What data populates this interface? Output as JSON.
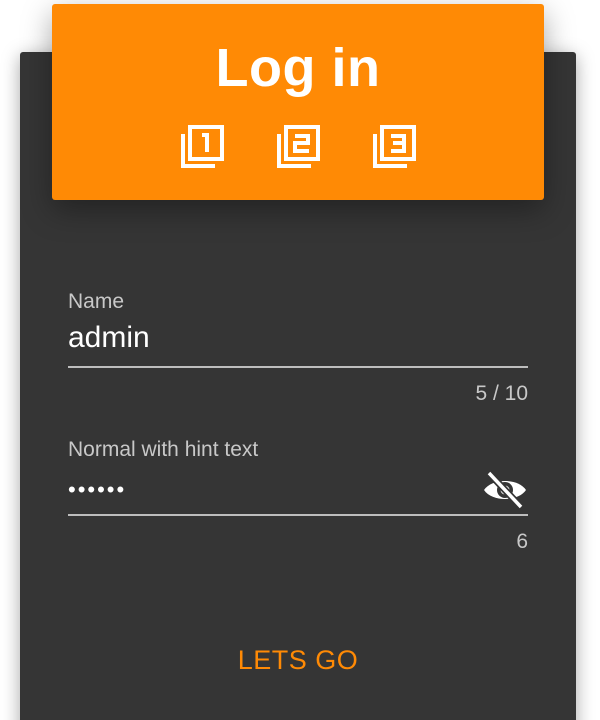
{
  "header": {
    "title": "Log in",
    "background_color": "#ff8a05",
    "icons": [
      {
        "name": "filter-1-icon",
        "digit": "1"
      },
      {
        "name": "filter-2-icon",
        "digit": "2"
      },
      {
        "name": "filter-3-icon",
        "digit": "3"
      }
    ]
  },
  "form": {
    "name_field": {
      "label": "Name",
      "value": "admin",
      "counter": "5 / 10"
    },
    "password_field": {
      "label": "Normal with hint text",
      "value": "••••••",
      "counter": "6",
      "toggle_icon": "visibility-off-icon"
    },
    "submit_label": "LETS GO"
  },
  "colors": {
    "card": "#353535",
    "accent": "#ff8a05",
    "text": "#ffffff",
    "muted": "#c8c8c8"
  }
}
